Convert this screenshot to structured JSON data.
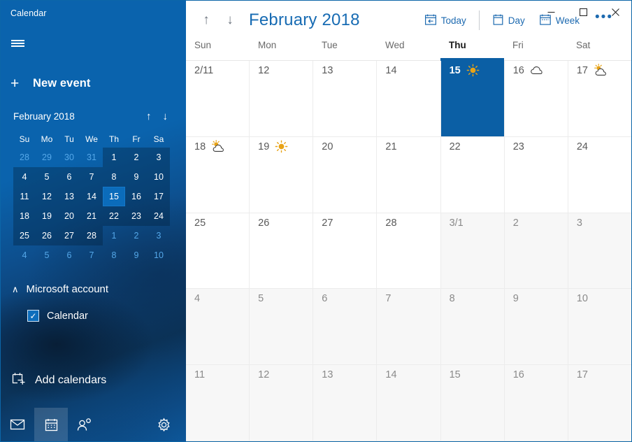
{
  "window": {
    "app_title": "Calendar",
    "controls": [
      {
        "name": "minimize",
        "glyph": "─"
      },
      {
        "name": "maximize",
        "glyph": "□"
      },
      {
        "name": "close",
        "glyph": "✕"
      }
    ]
  },
  "colors": {
    "sidebar_blue": "#0a63ad",
    "accent_blue": "#0b5fa5",
    "link_blue": "#176bb3",
    "today_mini": "#0b6cbb",
    "outside_day_bg": "#f7f7f7",
    "sun_orange": "#e8a317"
  },
  "sidebar": {
    "hamburger_label": "Menu",
    "new_event": {
      "plus": "+",
      "label": "New event"
    },
    "mini_calendar": {
      "month_label": "February 2018",
      "prev_glyph": "↑",
      "next_glyph": "↓",
      "day_initials": [
        "Su",
        "Mo",
        "Tu",
        "We",
        "Th",
        "Fr",
        "Sa"
      ],
      "weeks": [
        [
          {
            "n": "28",
            "outside": true
          },
          {
            "n": "29",
            "outside": true
          },
          {
            "n": "30",
            "outside": true
          },
          {
            "n": "31",
            "outside": true
          },
          {
            "n": "1"
          },
          {
            "n": "2"
          },
          {
            "n": "3"
          }
        ],
        [
          {
            "n": "4"
          },
          {
            "n": "5"
          },
          {
            "n": "6"
          },
          {
            "n": "7"
          },
          {
            "n": "8"
          },
          {
            "n": "9"
          },
          {
            "n": "10"
          }
        ],
        [
          {
            "n": "11"
          },
          {
            "n": "12"
          },
          {
            "n": "13"
          },
          {
            "n": "14"
          },
          {
            "n": "15",
            "today": true
          },
          {
            "n": "16"
          },
          {
            "n": "17"
          }
        ],
        [
          {
            "n": "18"
          },
          {
            "n": "19"
          },
          {
            "n": "20"
          },
          {
            "n": "21"
          },
          {
            "n": "22"
          },
          {
            "n": "23"
          },
          {
            "n": "24"
          }
        ],
        [
          {
            "n": "25"
          },
          {
            "n": "26"
          },
          {
            "n": "27"
          },
          {
            "n": "28"
          },
          {
            "n": "1",
            "outside": true
          },
          {
            "n": "2",
            "outside": true
          },
          {
            "n": "3",
            "outside": true
          }
        ],
        [
          {
            "n": "4",
            "outside": true
          },
          {
            "n": "5",
            "outside": true
          },
          {
            "n": "6",
            "outside": true
          },
          {
            "n": "7",
            "outside": true
          },
          {
            "n": "8",
            "outside": true
          },
          {
            "n": "9",
            "outside": true
          },
          {
            "n": "10",
            "outside": true
          }
        ]
      ]
    },
    "account": {
      "chevron": "∧",
      "label": "Microsoft account"
    },
    "calendar_checkbox": {
      "label": "Calendar",
      "checked": true,
      "check_glyph": "✓"
    },
    "add_calendars": {
      "label": "Add calendars",
      "icon": "add-calendar-icon"
    },
    "bottom_nav": [
      {
        "name": "mail-icon",
        "selected": false
      },
      {
        "name": "calendar-icon",
        "selected": true
      },
      {
        "name": "people-icon",
        "selected": false
      },
      {
        "name": "settings-gear-icon",
        "selected": false
      }
    ]
  },
  "toolbar": {
    "prev_glyph": "↑",
    "next_glyph": "↓",
    "title": "February 2018",
    "today_label": "Today",
    "day_label": "Day",
    "week_label": "Week",
    "ellipsis": "•••"
  },
  "calendar": {
    "day_headers": [
      {
        "label": "Sun",
        "current": false
      },
      {
        "label": "Mon",
        "current": false
      },
      {
        "label": "Tue",
        "current": false
      },
      {
        "label": "Wed",
        "current": false
      },
      {
        "label": "Thu",
        "current": true
      },
      {
        "label": "Fri",
        "current": false
      },
      {
        "label": "Sat",
        "current": false
      }
    ],
    "weeks": [
      [
        {
          "label": "2/11"
        },
        {
          "label": "12"
        },
        {
          "label": "13"
        },
        {
          "label": "14"
        },
        {
          "label": "15",
          "selected": true,
          "weather": "sunny"
        },
        {
          "label": "16",
          "weather": "cloudy"
        },
        {
          "label": "17",
          "weather": "partly-cloudy"
        }
      ],
      [
        {
          "label": "18",
          "weather": "partly-cloudy"
        },
        {
          "label": "19",
          "weather": "sunny"
        },
        {
          "label": "20"
        },
        {
          "label": "21"
        },
        {
          "label": "22"
        },
        {
          "label": "23"
        },
        {
          "label": "24"
        }
      ],
      [
        {
          "label": "25"
        },
        {
          "label": "26"
        },
        {
          "label": "27"
        },
        {
          "label": "28"
        },
        {
          "label": "3/1",
          "outside": true
        },
        {
          "label": "2",
          "outside": true
        },
        {
          "label": "3",
          "outside": true
        }
      ],
      [
        {
          "label": "4",
          "outside": true
        },
        {
          "label": "5",
          "outside": true
        },
        {
          "label": "6",
          "outside": true
        },
        {
          "label": "7",
          "outside": true
        },
        {
          "label": "8",
          "outside": true
        },
        {
          "label": "9",
          "outside": true
        },
        {
          "label": "10",
          "outside": true
        }
      ],
      [
        {
          "label": "11",
          "outside": true
        },
        {
          "label": "12",
          "outside": true
        },
        {
          "label": "13",
          "outside": true
        },
        {
          "label": "14",
          "outside": true
        },
        {
          "label": "15",
          "outside": true
        },
        {
          "label": "16",
          "outside": true
        },
        {
          "label": "17",
          "outside": true
        }
      ]
    ]
  }
}
